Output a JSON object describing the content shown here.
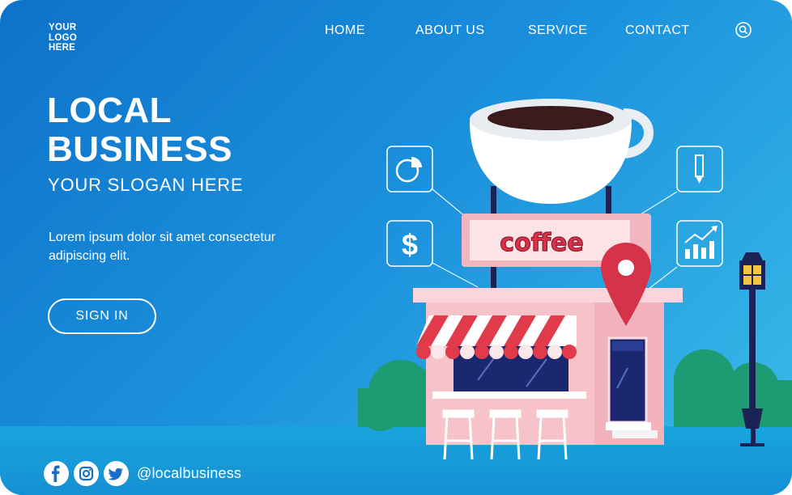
{
  "header": {
    "logo_text": "YOUR\nLOGO\nHERE",
    "nav": [
      "HOME",
      "ABOUT US",
      "SERVICE",
      "CONTACT"
    ],
    "search_icon": "search-icon"
  },
  "hero": {
    "title_line1": "LOCAL",
    "title_line2": "BUSINESS",
    "slogan": "YOUR SLOGAN HERE",
    "body": "Lorem ipsum dolor sit amet consectetur adipiscing elit.",
    "button": "SIGN IN"
  },
  "illustration": {
    "sign_text": "coffee",
    "icons": [
      "pie-chart-icon",
      "dollar-icon",
      "pencil-icon",
      "bar-chart-icon"
    ]
  },
  "footer": {
    "social_icons": [
      "facebook-icon",
      "instagram-icon",
      "twitter-icon"
    ],
    "handle": "@localbusiness"
  },
  "colors": {
    "background_start": "#0e72c9",
    "background_end": "#3bbde9",
    "shop_pink": "#f7c3cb",
    "sign_red": "#d8334a",
    "awning_red": "#e03a4b",
    "window_navy": "#1b2870"
  }
}
